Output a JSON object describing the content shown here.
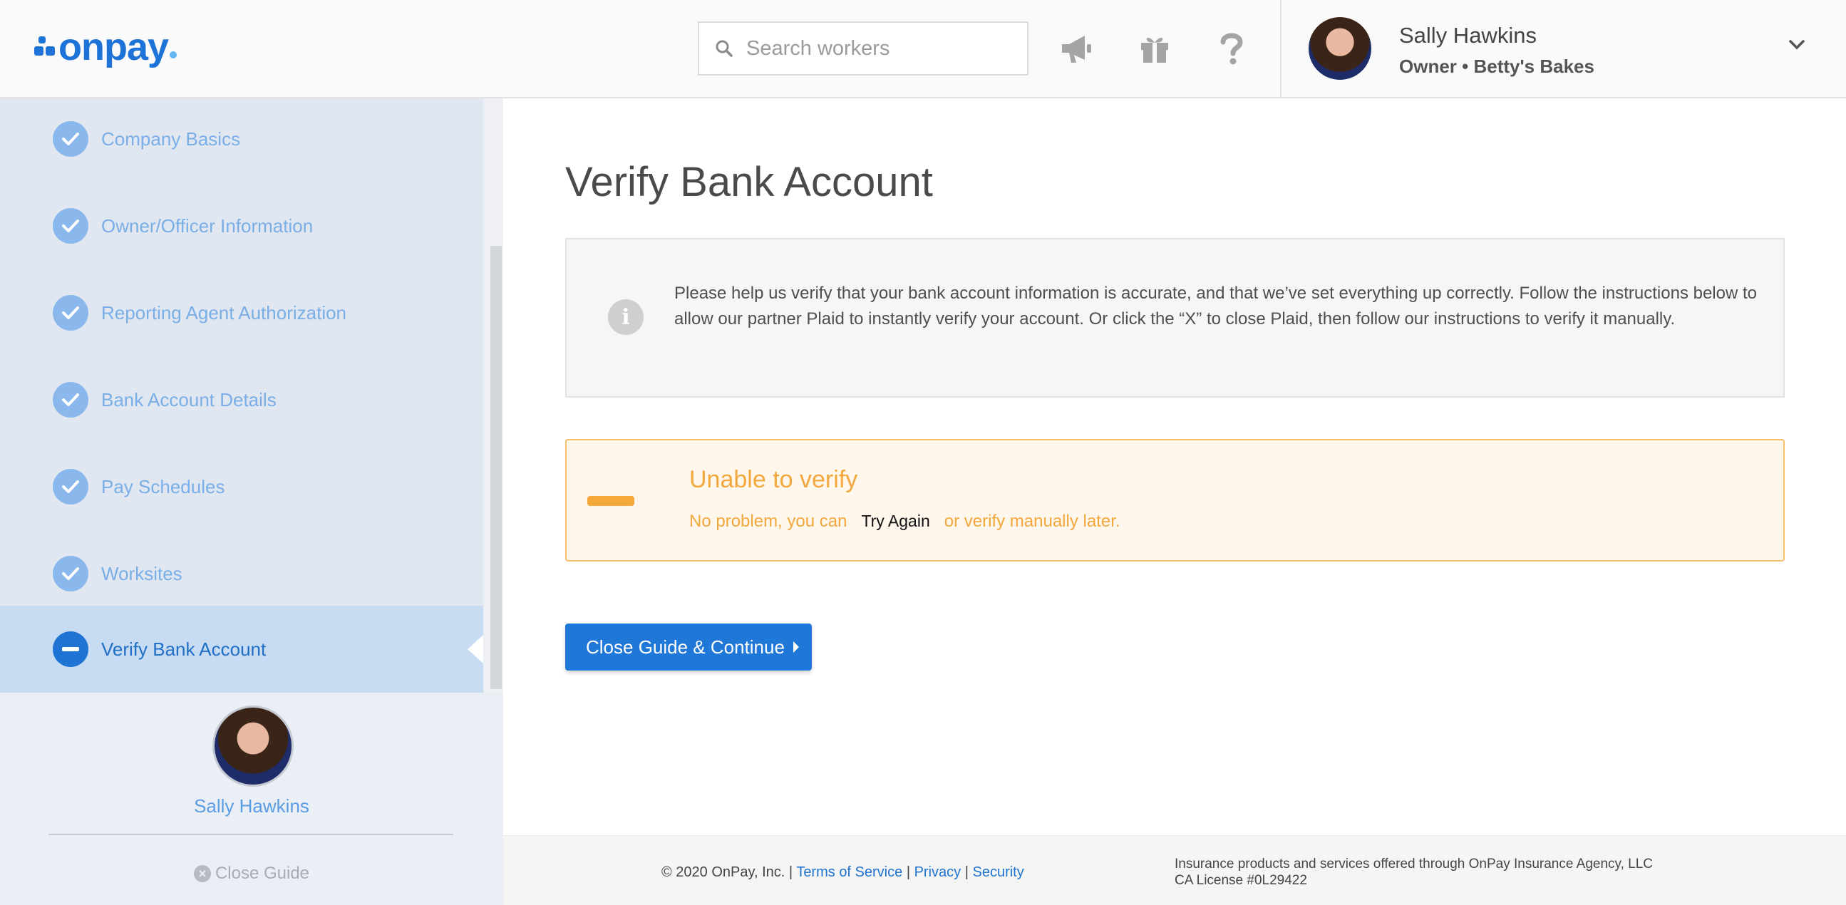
{
  "header": {
    "logo_text": "onpay",
    "search": {
      "placeholder": "Search workers",
      "value": ""
    },
    "icons": [
      "megaphone-icon",
      "gift-icon",
      "help-icon"
    ],
    "user": {
      "name": "Sally Hawkins",
      "role": "Owner • Betty's Bakes"
    }
  },
  "sidebar": {
    "steps": [
      {
        "label": "Company Basics",
        "status": "complete"
      },
      {
        "label": "Owner/Officer Information",
        "status": "complete"
      },
      {
        "label": "Reporting Agent Authorization",
        "status": "complete"
      },
      {
        "label": "Bank Account Details",
        "status": "complete"
      },
      {
        "label": "Pay Schedules",
        "status": "complete"
      },
      {
        "label": "Worksites",
        "status": "complete"
      },
      {
        "label": "Verify Bank Account",
        "status": "in-progress"
      }
    ],
    "guide_user": "Sally Hawkins",
    "close_guide": "Close Guide"
  },
  "main": {
    "title": "Verify Bank Account",
    "info": "Please help us verify that your bank account information is accurate, and that we’ve set everything up correctly. Follow the instructions below to allow our partner Plaid to instantly verify your account. Or click the “X” to close Plaid, then follow our instructions to verify it manually.",
    "warning": {
      "title": "Unable to verify",
      "prefix": "No problem, you can",
      "action": "Try Again",
      "suffix": "or verify manually later."
    },
    "cta": "Close Guide & Continue"
  },
  "footer": {
    "copyright": "© 2020 OnPay, Inc. |",
    "links": [
      "Terms of Service",
      "Privacy",
      "Security"
    ],
    "sep": "|",
    "insurance_line1": "Insurance products and services offered through OnPay Insurance Agency, LLC",
    "insurance_line2": "CA License #0L29422"
  },
  "colors": {
    "brand": "#1e73d8",
    "complete_step": "#8ab8ec",
    "active_step_bg": "#c7dcf3",
    "warning": "#f2a83c",
    "warning_bg": "#fff6ec"
  }
}
